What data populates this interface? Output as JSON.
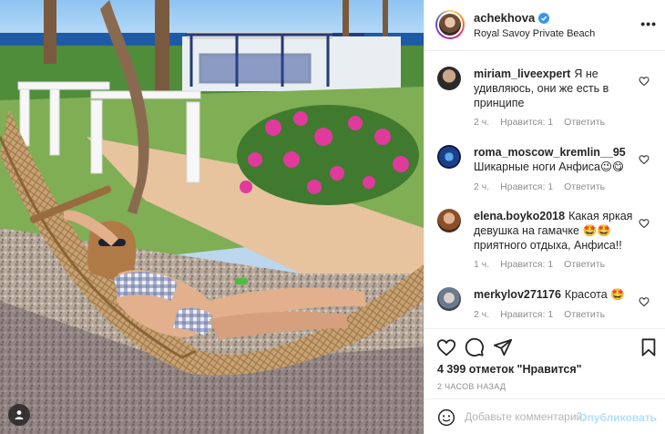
{
  "post": {
    "username": "achekhova",
    "location": "Royal Savoy Private Beach",
    "more_label": "•••"
  },
  "comments": [
    {
      "username": "miriam_liveexpert",
      "text": "Я не удивляюсь, они же есть в принципе",
      "time": "2 ч.",
      "likes": "Нравится: 1",
      "reply": "Ответить"
    },
    {
      "username": "roma_moscow_kremlin__95",
      "text": "Шикарные ноги Анфиса😉😋",
      "time": "2 ч.",
      "likes": "Нравится: 1",
      "reply": "Ответить"
    },
    {
      "username": "elena.boyko2018",
      "text": "Какая яркая девушка на гамачке 🤩🤩 приятного отдыха, Анфиса!!",
      "time": "1 ч.",
      "likes": "Нравится: 1",
      "reply": "Ответить"
    },
    {
      "username": "merkylov271176",
      "text": "Красота 🤩",
      "time": "2 ч.",
      "likes": "Нравится: 1",
      "reply": "Ответить"
    }
  ],
  "stats": {
    "likes": "4 399 отметок \"Нравится\"",
    "time_ago": "2 часов назад"
  },
  "composer": {
    "placeholder": "Добавьте комментарий...",
    "publish_label": "Опубликовать"
  },
  "icons": {
    "like": "heart-icon",
    "comment": "comment-bubble-icon",
    "share": "paper-plane-icon",
    "save": "bookmark-icon",
    "emoji": "smiley-icon",
    "tags": "user-tag-icon",
    "verified": "verified-badge-icon"
  },
  "colors": {
    "verified": "#3897f0",
    "publish_disabled": "#b2dffc",
    "secondary_text": "#8e8e8e",
    "primary_text": "#262626"
  }
}
